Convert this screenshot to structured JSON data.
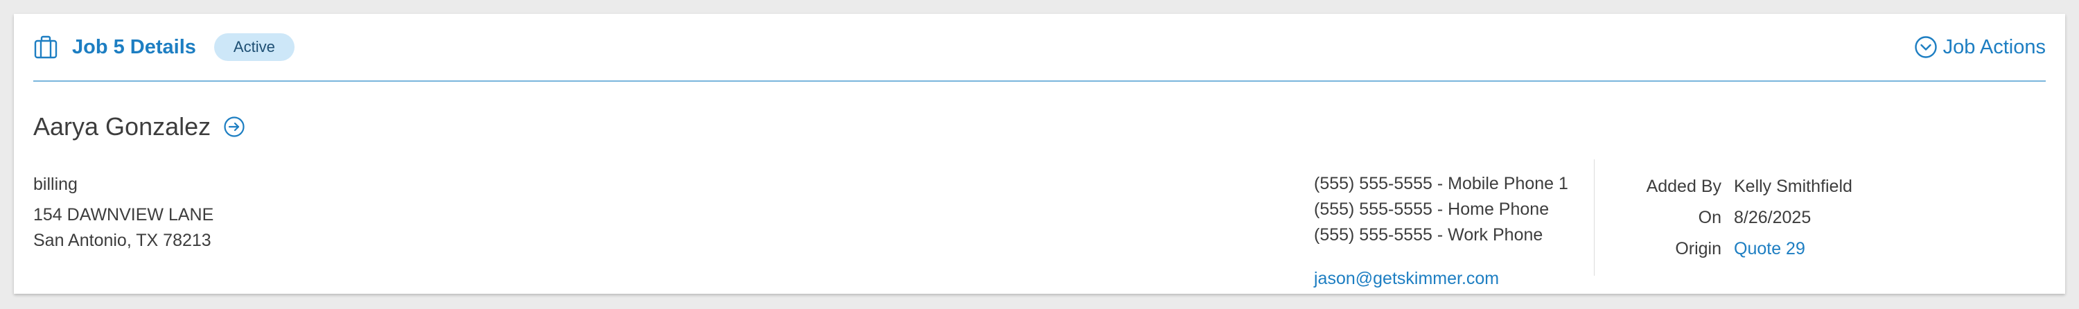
{
  "header": {
    "title": "Job 5 Details",
    "status": "Active",
    "actions_label": "Job Actions",
    "icon": "briefcase-icon",
    "accent_color": "#1d7ec2"
  },
  "customer": {
    "name": "Aarya Gonzalez"
  },
  "billing": {
    "label": "billing",
    "address_line1": "154 DAWNVIEW LANE",
    "address_line2": "San Antonio, TX 78213"
  },
  "contacts": {
    "phones": [
      "(555) 555-5555 - Mobile Phone 1",
      "(555) 555-5555 - Home Phone",
      "(555) 555-5555 - Work Phone"
    ],
    "email": "jason@getskimmer.com"
  },
  "meta": {
    "added_by_label": "Added By",
    "added_by": "Kelly Smithfield",
    "on_label": "On",
    "on": "8/26/2025",
    "origin_label": "Origin",
    "origin": "Quote 29"
  }
}
